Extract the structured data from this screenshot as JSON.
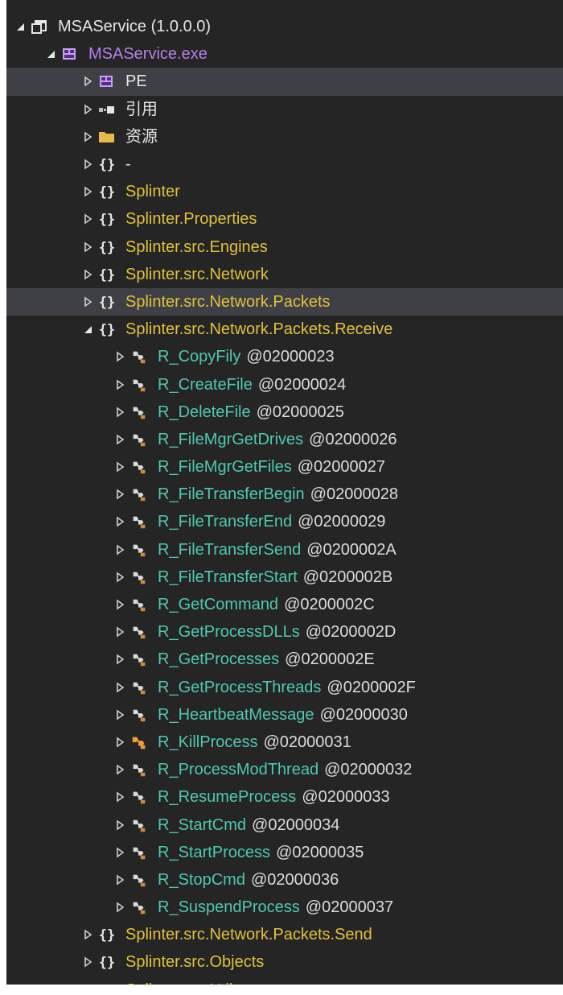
{
  "colors": {
    "background": "#252526",
    "selection": "#3f3f46",
    "namespace": "#e2c13a",
    "class": "#4ec9b0",
    "module": "#b97fe8"
  },
  "tree": {
    "assembly": {
      "label": "MSAService (1.0.0.0)",
      "icon": "assembly-icon",
      "expanded": true
    },
    "module": {
      "label": "MSAService.exe",
      "icon": "module-icon",
      "expanded": true
    },
    "nodes": [
      {
        "label": "PE",
        "icon": "module-icon",
        "selected": true
      },
      {
        "label": "引用",
        "icon": "references-icon"
      },
      {
        "label": "资源",
        "icon": "folder-icon"
      },
      {
        "label": "-",
        "icon": "namespace-icon"
      },
      {
        "label": "Splinter",
        "icon": "namespace-icon"
      },
      {
        "label": "Splinter.Properties",
        "icon": "namespace-icon"
      },
      {
        "label": "Splinter.src.Engines",
        "icon": "namespace-icon"
      },
      {
        "label": "Splinter.src.Network",
        "icon": "namespace-icon"
      },
      {
        "label": "Splinter.src.Network.Packets",
        "icon": "namespace-icon",
        "hover": true
      }
    ],
    "expanded_namespace": {
      "label": "Splinter.src.Network.Packets.Receive",
      "icon": "namespace-icon",
      "expanded": true
    },
    "classes": [
      {
        "name": "R_CopyFily",
        "token": "@02000023"
      },
      {
        "name": "R_CreateFile",
        "token": "@02000024"
      },
      {
        "name": "R_DeleteFile",
        "token": "@02000025"
      },
      {
        "name": "R_FileMgrGetDrives",
        "token": "@02000026"
      },
      {
        "name": "R_FileMgrGetFiles",
        "token": "@02000027"
      },
      {
        "name": "R_FileTransferBegin",
        "token": "@02000028"
      },
      {
        "name": "R_FileTransferEnd",
        "token": "@02000029"
      },
      {
        "name": "R_FileTransferSend",
        "token": "@0200002A"
      },
      {
        "name": "R_FileTransferStart",
        "token": "@0200002B"
      },
      {
        "name": "R_GetCommand",
        "token": "@0200002C"
      },
      {
        "name": "R_GetProcessDLLs",
        "token": "@0200002D"
      },
      {
        "name": "R_GetProcesses",
        "token": "@0200002E"
      },
      {
        "name": "R_GetProcessThreads",
        "token": "@0200002F"
      },
      {
        "name": "R_HeartbeatMessage",
        "token": "@02000030"
      },
      {
        "name": "R_KillProcess",
        "token": "@02000031",
        "icon_variant": "orange"
      },
      {
        "name": "R_ProcessModThread",
        "token": "@02000032"
      },
      {
        "name": "R_ResumeProcess",
        "token": "@02000033"
      },
      {
        "name": "R_StartCmd",
        "token": "@02000034"
      },
      {
        "name": "R_StartProcess",
        "token": "@02000035"
      },
      {
        "name": "R_StopCmd",
        "token": "@02000036"
      },
      {
        "name": "R_SuspendProcess",
        "token": "@02000037"
      }
    ],
    "trailing_nodes": [
      {
        "label": "Splinter.src.Network.Packets.Send",
        "icon": "namespace-icon"
      },
      {
        "label": "Splinter.src.Objects",
        "icon": "namespace-icon"
      },
      {
        "label": "Splinter.src.Utils",
        "icon": "namespace-icon"
      }
    ]
  }
}
